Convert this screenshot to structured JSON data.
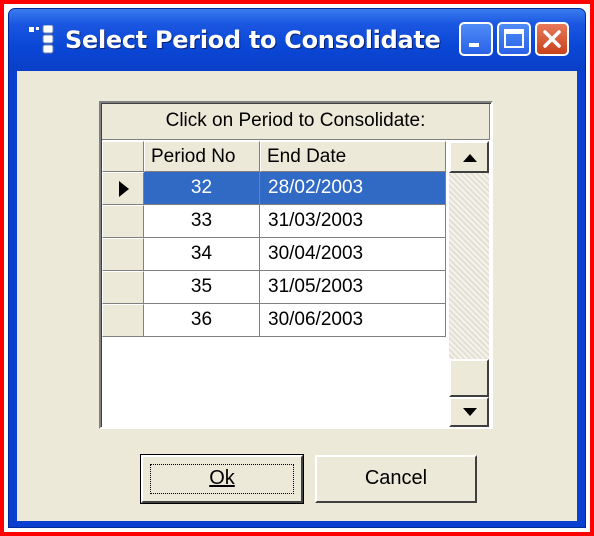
{
  "window": {
    "title": "Select Period to Consolidate",
    "controls": [
      "minimize-icon",
      "maximize-icon",
      "close-icon"
    ]
  },
  "grid": {
    "caption": "Click on Period to Consolidate:",
    "columns": [
      "Period No",
      "End Date"
    ],
    "rows": [
      {
        "period_no": "32",
        "end_date": "28/02/2003",
        "selected": true
      },
      {
        "period_no": "33",
        "end_date": "31/03/2003",
        "selected": false
      },
      {
        "period_no": "34",
        "end_date": "30/04/2003",
        "selected": false
      },
      {
        "period_no": "35",
        "end_date": "31/05/2003",
        "selected": false
      },
      {
        "period_no": "36",
        "end_date": "30/06/2003",
        "selected": false
      }
    ]
  },
  "buttons": {
    "ok": "Ok",
    "cancel": "Cancel"
  },
  "colors": {
    "titlebar": "#0a47d6",
    "selection": "#316ac5",
    "dialog_bg": "#ece9d8",
    "frame": "#ff0000"
  }
}
